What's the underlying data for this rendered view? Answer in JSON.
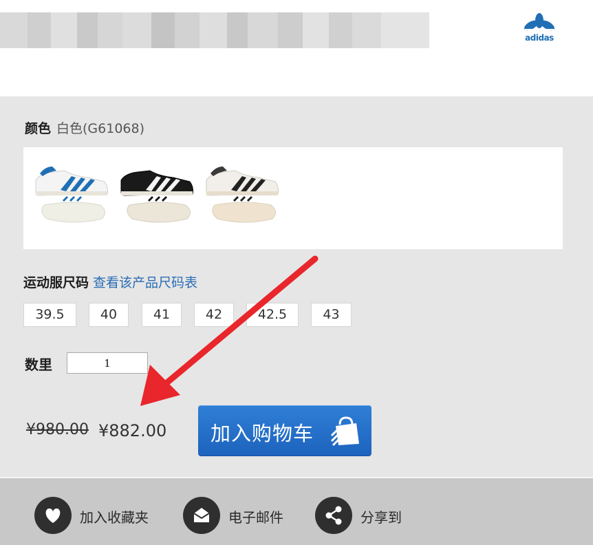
{
  "header": {
    "brand_logo": "adidas",
    "title_blurred": true
  },
  "product": {
    "color_label": "颜色",
    "color_value": "白色(G61068)",
    "swatches": [
      {
        "name": "white-blue",
        "stripe_color": "#1f6fb5",
        "upper_color": "#f4f4f4"
      },
      {
        "name": "black-white",
        "stripe_color": "#f4f4f4",
        "upper_color": "#1a1a1a"
      },
      {
        "name": "white-black",
        "stripe_color": "#222222",
        "upper_color": "#f2efea"
      }
    ],
    "size_label": "运动服尺码",
    "size_chart_link": "查看该产品尺码表",
    "sizes": [
      "39.5",
      "40",
      "41",
      "42",
      "42.5",
      "43"
    ],
    "qty_label": "数里",
    "qty_value": "1",
    "old_price": "¥980.00",
    "new_price": "¥882.00",
    "add_to_cart": "加入购物车"
  },
  "footer": {
    "favorite": "加入收藏夹",
    "email": "电子邮件",
    "share": "分享到"
  },
  "colors": {
    "accent_blue": "#1f6fb5",
    "annotation_red": "#e8262b",
    "panel_gray": "#e6e6e6",
    "footer_gray": "#c8c8c8"
  }
}
